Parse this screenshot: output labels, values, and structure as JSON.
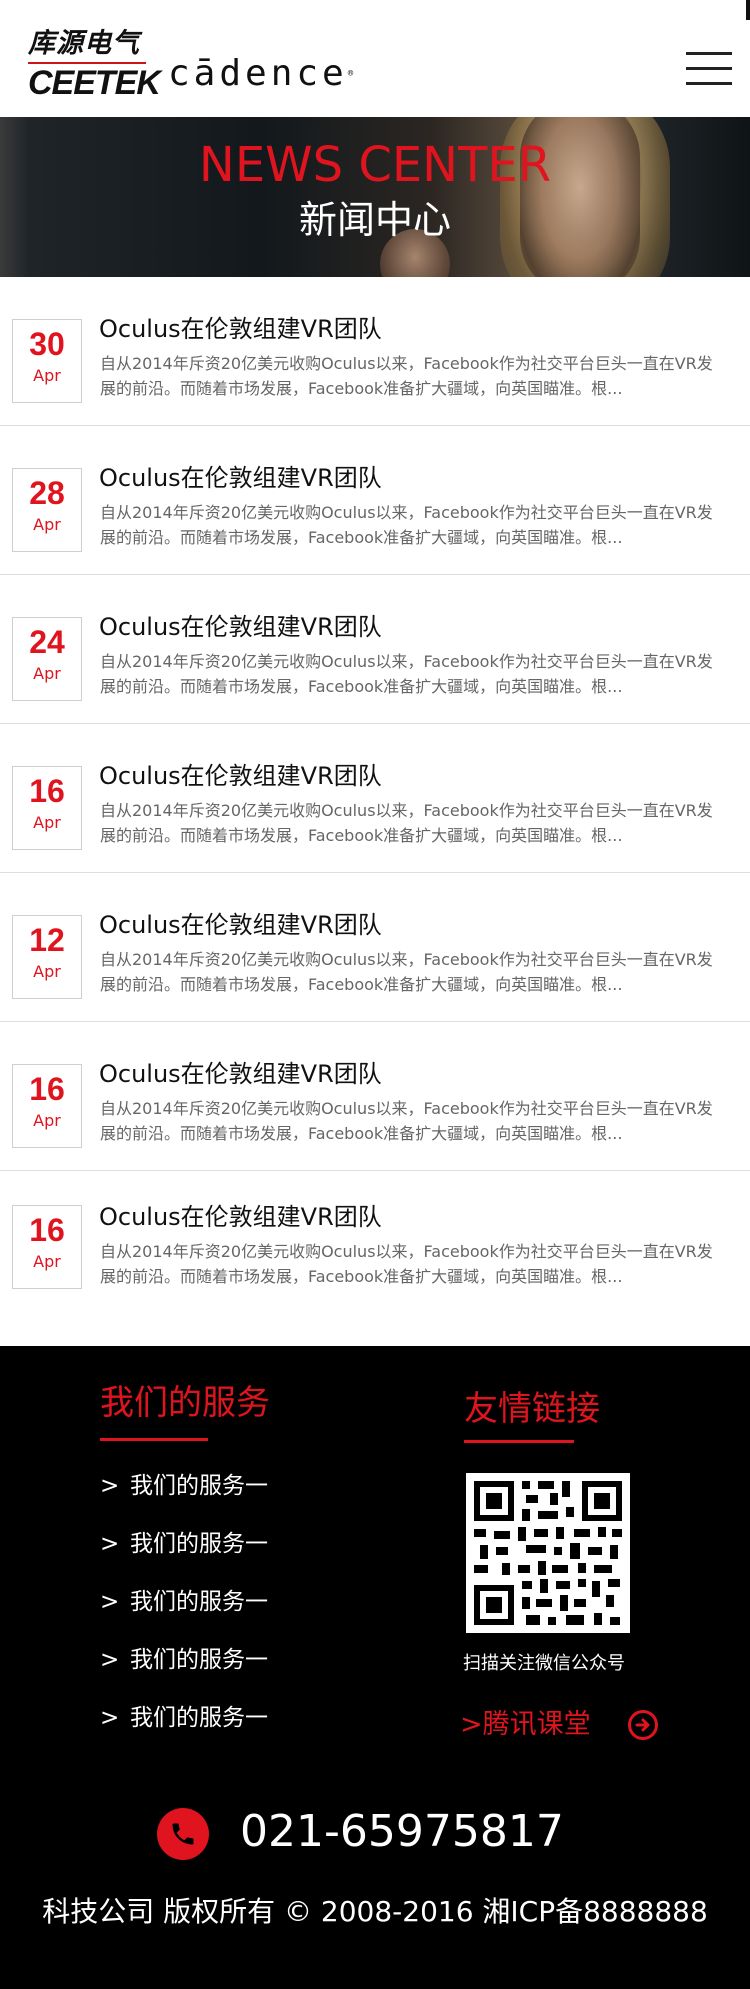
{
  "header": {
    "logo_cn": "库源电气",
    "logo_en": "CEETEK",
    "partner_logo": "cādence",
    "menu_icon": "hamburger-menu-icon"
  },
  "banner": {
    "title_en": "NEWS CENTER",
    "title_cn": "新闻中心"
  },
  "news": [
    {
      "day": "30",
      "month": "Apr",
      "title": "Oculus在伦敦组建VR团队",
      "summary": "自从2014年斥资20亿美元收购Oculus以来，Facebook作为社交平台巨头一直在VR发展的前沿。而随着市场发展，Facebook准备扩大疆域，向英国瞄准。根..."
    },
    {
      "day": "28",
      "month": "Apr",
      "title": "Oculus在伦敦组建VR团队",
      "summary": "自从2014年斥资20亿美元收购Oculus以来，Facebook作为社交平台巨头一直在VR发展的前沿。而随着市场发展，Facebook准备扩大疆域，向英国瞄准。根..."
    },
    {
      "day": "24",
      "month": "Apr",
      "title": "Oculus在伦敦组建VR团队",
      "summary": "自从2014年斥资20亿美元收购Oculus以来，Facebook作为社交平台巨头一直在VR发展的前沿。而随着市场发展，Facebook准备扩大疆域，向英国瞄准。根..."
    },
    {
      "day": "16",
      "month": "Apr",
      "title": "Oculus在伦敦组建VR团队",
      "summary": "自从2014年斥资20亿美元收购Oculus以来，Facebook作为社交平台巨头一直在VR发展的前沿。而随着市场发展，Facebook准备扩大疆域，向英国瞄准。根..."
    },
    {
      "day": "12",
      "month": "Apr",
      "title": "Oculus在伦敦组建VR团队",
      "summary": "自从2014年斥资20亿美元收购Oculus以来，Facebook作为社交平台巨头一直在VR发展的前沿。而随着市场发展，Facebook准备扩大疆域，向英国瞄准。根..."
    },
    {
      "day": "16",
      "month": "Apr",
      "title": "Oculus在伦敦组建VR团队",
      "summary": "自从2014年斥资20亿美元收购Oculus以来，Facebook作为社交平台巨头一直在VR发展的前沿。而随着市场发展，Facebook准备扩大疆域，向英国瞄准。根..."
    },
    {
      "day": "16",
      "month": "Apr",
      "title": "Oculus在伦敦组建VR团队",
      "summary": "自从2014年斥资20亿美元收购Oculus以来，Facebook作为社交平台巨头一直在VR发展的前沿。而随着市场发展，Facebook准备扩大疆域，向英国瞄准。根..."
    }
  ],
  "footer": {
    "services_title": "我们的服务",
    "services": [
      "我们的服务一",
      "我们的服务一",
      "我们的服务一",
      "我们的服务一",
      "我们的服务一"
    ],
    "service_arrow": ">",
    "links_title": "友情链接",
    "qr_caption": "扫描关注微信公众号",
    "tencent_link": ">腾讯课堂",
    "phone": "021-65975817",
    "copyright": "科技公司 版权所有 © 2008-2016 湘ICP备8888888"
  },
  "colors": {
    "accent": "#e0141e",
    "footer_bg": "#000000"
  }
}
